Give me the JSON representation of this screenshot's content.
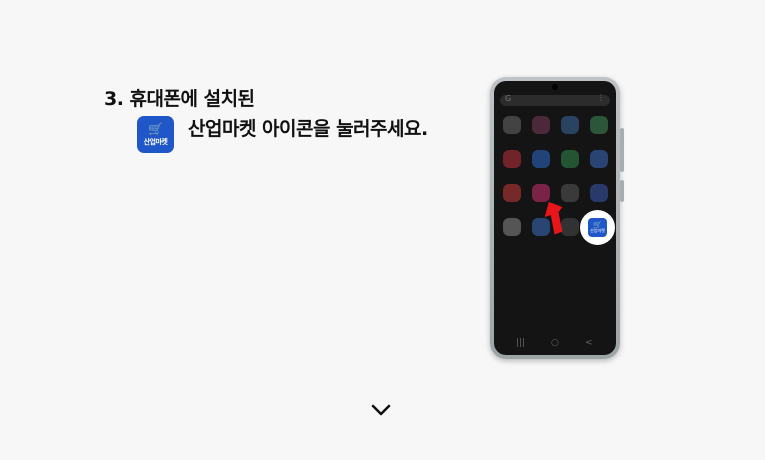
{
  "step": {
    "title": "3. 휴대폰에 설치된",
    "instruction": "산업마켓 아이콘을 눌러주세요.",
    "app_icon_label": "산업마켓"
  },
  "colors": {
    "brand": "#1f57c8",
    "arrow": "#e8151b",
    "background": "#f7f7f7",
    "screen": "#141414"
  },
  "phone": {
    "search_glyph": "G",
    "menu_glyph": "⋮",
    "app_grid_colors": [
      [
        "#6a6a6a",
        "#7a3a5a",
        "#3a6aa0",
        "#3f8a5a"
      ],
      [
        "#c0303a",
        "#2b6ac8",
        "#2f8a4a",
        "#3a6ac0"
      ],
      [
        "#c83a3a",
        "#d03070",
        "#5a5a5a",
        "#3a5ab0"
      ],
      [
        "#8a8a8a",
        "#3a70c0",
        "#4a4a4a",
        "#1f57c8"
      ]
    ],
    "nav_icons": [
      "|||",
      "○",
      "<"
    ],
    "highlighted_app_label": "산업마켓"
  },
  "icons": {
    "cart": "cart-icon",
    "scroll_down": "chevron-down-icon"
  }
}
